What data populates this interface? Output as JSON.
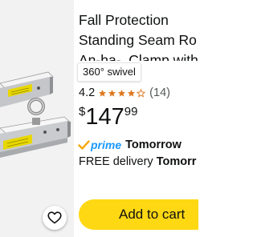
{
  "product": {
    "title_lines": [
      "Fall Protection",
      "Standing Seam Ro",
      "An-ha-, Clamp with"
    ],
    "badge": "360° swivel",
    "rating": {
      "value": "4.2",
      "stars": 4.2,
      "count_text": "(14)"
    },
    "price": {
      "currency": "$",
      "whole": "147",
      "fraction": "99"
    },
    "prime": {
      "word": "prime",
      "day": "Tomorrow"
    },
    "delivery": {
      "prefix": "FREE delivery",
      "day": "Tomorr"
    },
    "cart_button": "Add to cart"
  },
  "icons": {
    "wishlist": "heart-outline-icon",
    "prime_check": "prime-check-icon",
    "star": "star-icon"
  },
  "colors": {
    "cart_button": "#ffd814",
    "star": "#de7921",
    "prime": "#1a98ff",
    "text": "#0f1111",
    "secondary_text": "#565959"
  }
}
